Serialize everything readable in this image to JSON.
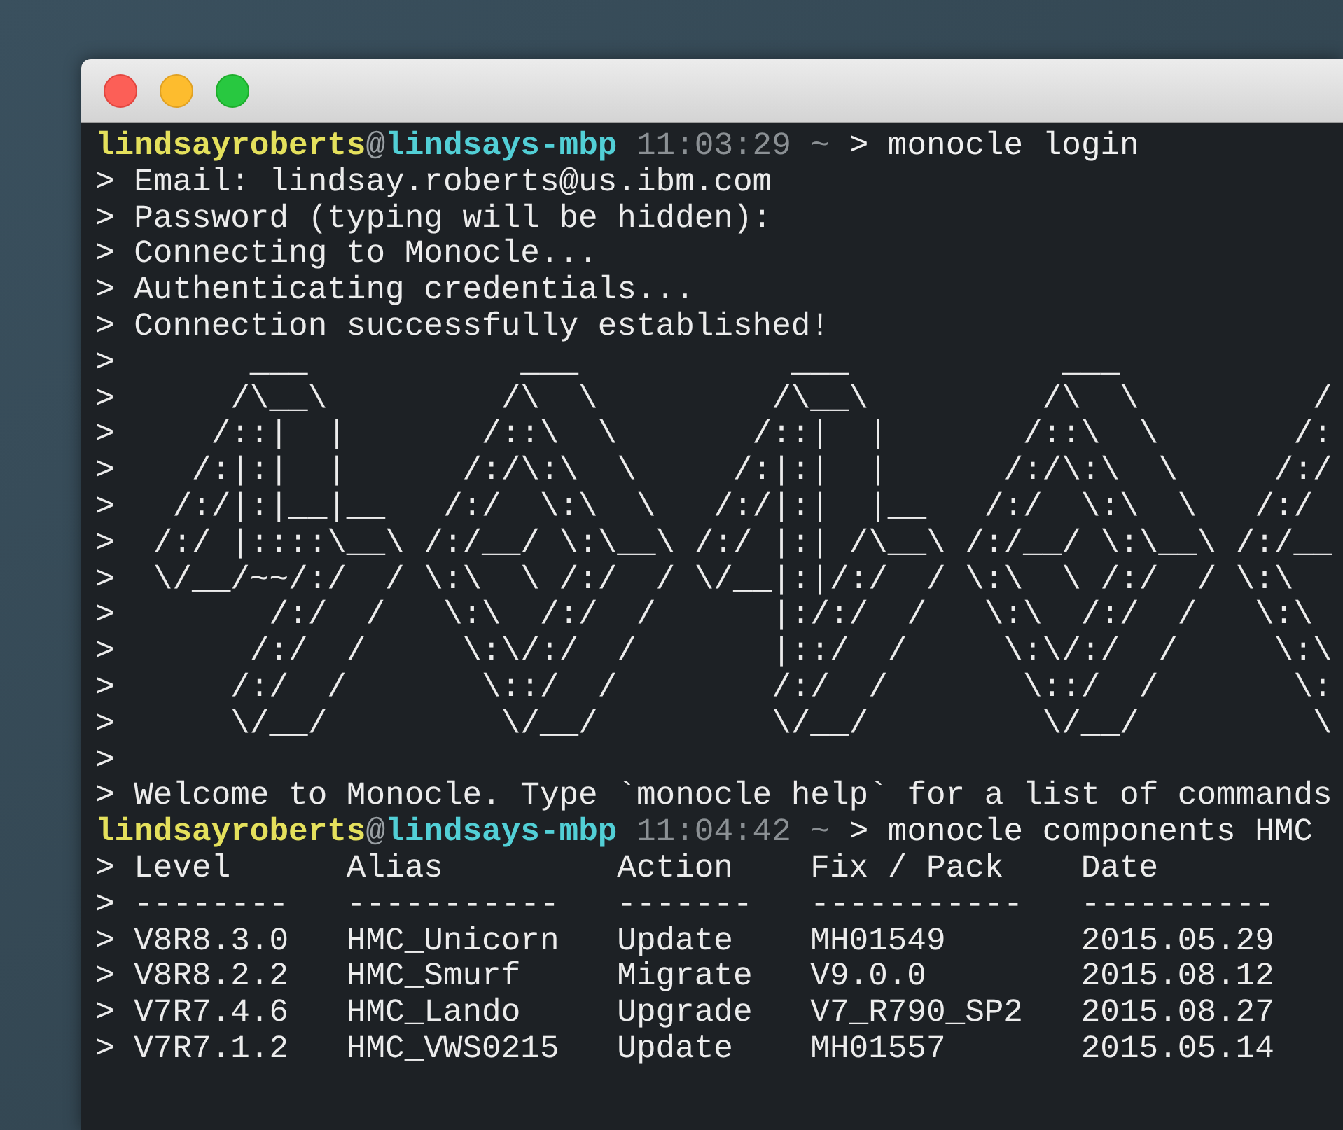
{
  "window": {
    "buttons": [
      {
        "kind": "close"
      },
      {
        "kind": "minimize"
      },
      {
        "kind": "zoom"
      }
    ]
  },
  "terminal": {
    "lines": [
      {
        "kind": "prompt",
        "user": "lindsayroberts",
        "at": "@",
        "host": "lindsays-mbp",
        "time": "11:03:29",
        "cwd": "~",
        "command": "> monocle login"
      },
      {
        "kind": "output",
        "text": "> Email: lindsay.roberts@us.ibm.com"
      },
      {
        "kind": "output",
        "text": "> Password (typing will be hidden):"
      },
      {
        "kind": "output",
        "text": "> Connecting to Monocle..."
      },
      {
        "kind": "output",
        "text": "> Authenticating credentials..."
      },
      {
        "kind": "output",
        "text": "> Connection successfully established!"
      },
      {
        "kind": "art",
        "text": ">       ___           ___           ___           ___"
      },
      {
        "kind": "art",
        "text": ">      /\\__\\         /\\  \\         /\\__\\         /\\  \\         /"
      },
      {
        "kind": "art",
        "text": ">     /::|  |       /::\\  \\       /::|  |       /::\\  \\       /:"
      },
      {
        "kind": "art",
        "text": ">    /:|:|  |      /:/\\:\\  \\     /:|:|  |      /:/\\:\\  \\     /:/"
      },
      {
        "kind": "art",
        "text": ">   /:/|:|__|__   /:/  \\:\\  \\   /:/|:|  |__   /:/  \\:\\  \\   /:/"
      },
      {
        "kind": "art",
        "text": ">  /:/ |::::\\__\\ /:/__/ \\:\\__\\ /:/ |:| /\\__\\ /:/__/ \\:\\__\\ /:/__"
      },
      {
        "kind": "art",
        "text": ">  \\/__/~~/:/  / \\:\\  \\ /:/  / \\/__|:|/:/  / \\:\\  \\ /:/  / \\:\\"
      },
      {
        "kind": "art",
        "text": ">        /:/  /   \\:\\  /:/  /      |:/:/  /   \\:\\  /:/  /   \\:\\"
      },
      {
        "kind": "art",
        "text": ">       /:/  /     \\:\\/:/  /       |::/  /     \\:\\/:/  /     \\:\\"
      },
      {
        "kind": "art",
        "text": ">      /:/  /       \\::/  /        /:/  /       \\::/  /       \\:"
      },
      {
        "kind": "art",
        "text": ">      \\/__/         \\/__/         \\/__/         \\/__/         \\"
      },
      {
        "kind": "output",
        "text": ">"
      },
      {
        "kind": "output",
        "text": "> Welcome to Monocle. Type `monocle help` for a list of commands"
      },
      {
        "kind": "prompt",
        "user": "lindsayroberts",
        "at": "@",
        "host": "lindsays-mbp",
        "time": "11:04:42",
        "cwd": "~",
        "command": "> monocle components HMC"
      },
      {
        "kind": "table",
        "columns": [
          "> Level",
          "Alias",
          "Action",
          "Fix / Pack",
          "Date"
        ],
        "rule": [
          "> --------",
          "-----------",
          "-------",
          "-----------",
          "----------"
        ],
        "rows": [
          [
            "> V8R8.3.0",
            "HMC_Unicorn",
            "Update",
            "MH01549",
            "2015.05.29"
          ],
          [
            "> V8R8.2.2",
            "HMC_Smurf",
            "Migrate",
            "V9.0.0",
            "2015.08.12"
          ],
          [
            "> V7R7.4.6",
            "HMC_Lando",
            "Upgrade",
            "V7_R790_SP2",
            "2015.08.27"
          ],
          [
            "> V7R7.1.2",
            "HMC_VWS0215",
            "Update",
            "MH01557",
            "2015.05.14"
          ]
        ]
      }
    ]
  }
}
